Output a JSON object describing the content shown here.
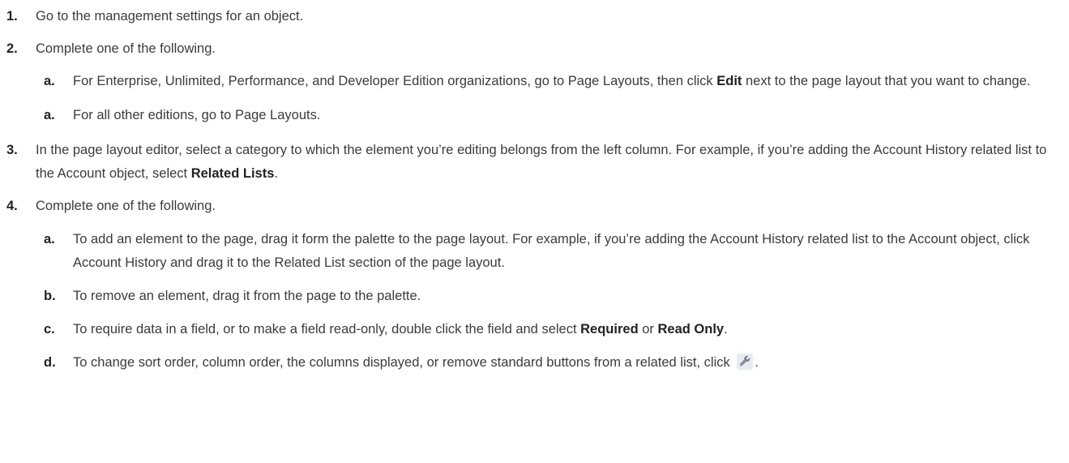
{
  "steps": [
    {
      "number": "1.",
      "text": "Go to the management settings for an object."
    },
    {
      "number": "2.",
      "text": "Complete one of the following.",
      "subs": [
        {
          "letter": "a.",
          "pre": "For Enterprise, Unlimited, Performance, and Developer Edition organizations, go to Page Layouts, then click ",
          "bold": "Edit",
          "post": " next to the page layout that you want to change."
        },
        {
          "letter": "a.",
          "text": "For all other editions, go to Page Layouts."
        }
      ]
    },
    {
      "number": "3.",
      "pre": "In the page layout editor, select a category to which the element you’re editing belongs from the left column. For example, if you’re adding the Account History related list to the Account object, select ",
      "bold": "Related Lists",
      "post": "."
    },
    {
      "number": "4.",
      "text": "Complete one of the following.",
      "subs": [
        {
          "letter": "a.",
          "text": "To add an element to the page, drag it form the palette to the page layout. For example, if you’re adding the Account History related list to the Account object, click Account History and drag it to the Related List section of the page layout."
        },
        {
          "letter": "b.",
          "text": "To remove an element, drag it from the page to the palette."
        },
        {
          "letter": "c.",
          "pre": "To require data in a field, or to make a field read-only, double click the field and select ",
          "bold": "Required",
          "mid": " or ",
          "bold2": "Read Only",
          "post": "."
        },
        {
          "letter": "d.",
          "pre": "To change sort order, column order, the columns displayed, or remove standard buttons from a related list, click ",
          "icon": "wrench-icon",
          "post": "."
        }
      ]
    }
  ]
}
